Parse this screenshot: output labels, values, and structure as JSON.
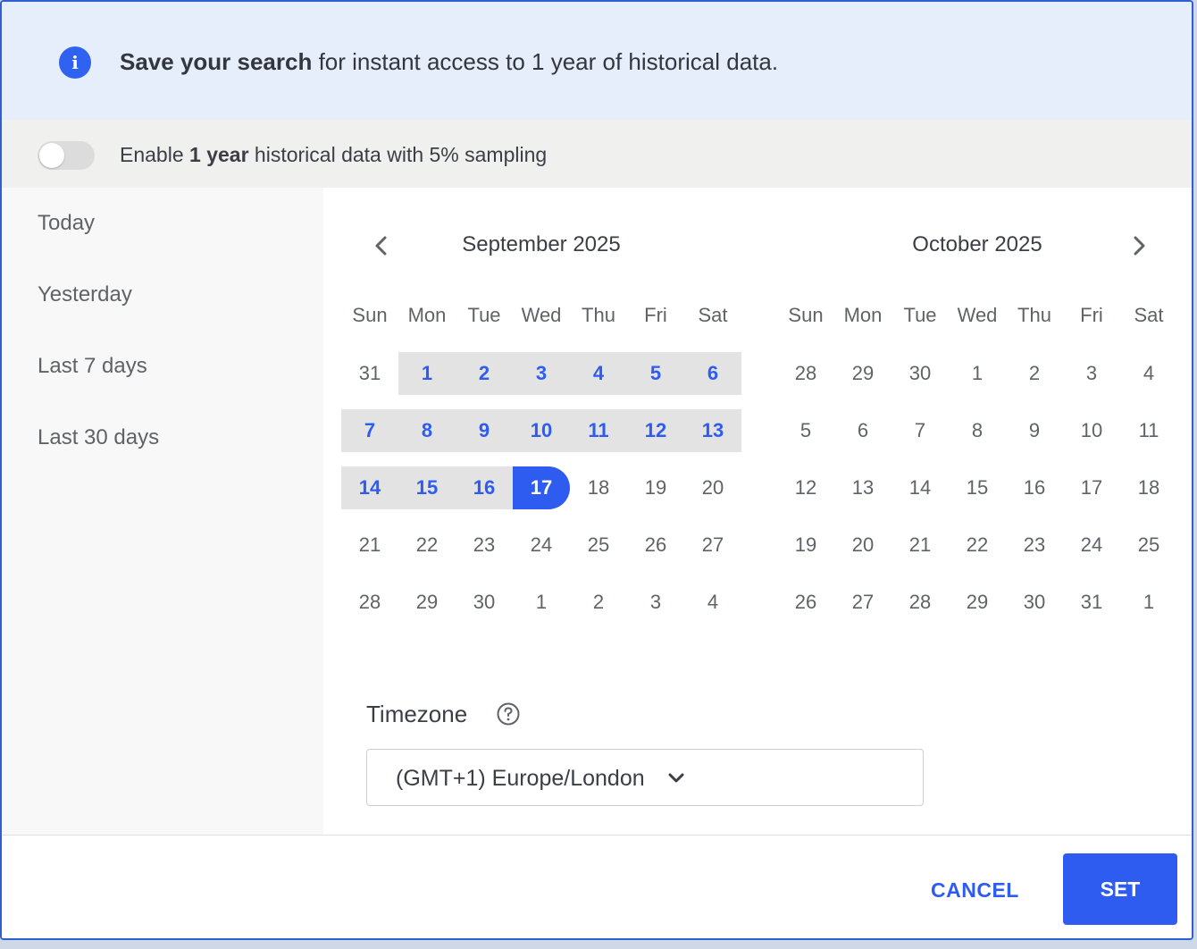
{
  "banner": {
    "bold": "Save your search",
    "rest": " for instant access to 1 year of historical data."
  },
  "toggle": {
    "pre": "Enable ",
    "bold": "1 year",
    "post": " historical data with 5% sampling",
    "on": false
  },
  "presets": [
    "Today",
    "Yesterday",
    "Last 7 days",
    "Last 30 days"
  ],
  "weekdays": [
    "Sun",
    "Mon",
    "Tue",
    "Wed",
    "Thu",
    "Fri",
    "Sat"
  ],
  "months": [
    {
      "title": "September 2025",
      "weeks": [
        [
          "31",
          "1",
          "2",
          "3",
          "4",
          "5",
          "6"
        ],
        [
          "7",
          "8",
          "9",
          "10",
          "11",
          "12",
          "13"
        ],
        [
          "14",
          "15",
          "16",
          "17",
          "18",
          "19",
          "20"
        ],
        [
          "21",
          "22",
          "23",
          "24",
          "25",
          "26",
          "27"
        ],
        [
          "28",
          "29",
          "30",
          "1",
          "2",
          "3",
          "4"
        ]
      ],
      "range_start": "1",
      "range_end": "17"
    },
    {
      "title": "October 2025",
      "weeks": [
        [
          "28",
          "29",
          "30",
          "1",
          "2",
          "3",
          "4"
        ],
        [
          "5",
          "6",
          "7",
          "8",
          "9",
          "10",
          "11"
        ],
        [
          "12",
          "13",
          "14",
          "15",
          "16",
          "17",
          "18"
        ],
        [
          "19",
          "20",
          "21",
          "22",
          "23",
          "24",
          "25"
        ],
        [
          "26",
          "27",
          "28",
          "29",
          "30",
          "31",
          "1"
        ]
      ]
    }
  ],
  "timezone": {
    "label": "Timezone",
    "value": "(GMT+1) Europe/London"
  },
  "footer": {
    "cancel": "CANCEL",
    "set": "SET"
  },
  "colors": {
    "accent": "#2f5cf0",
    "range_bg": "#e3e3e3",
    "banner_bg": "#e6edfb"
  }
}
